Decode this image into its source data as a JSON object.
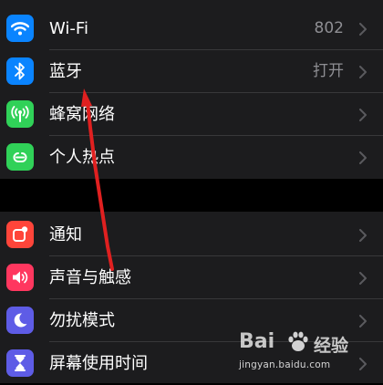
{
  "settings": {
    "group1": [
      {
        "label": "Wi-Fi",
        "value": "802",
        "icon": "wifi-icon",
        "color": "#0a84ff"
      },
      {
        "label": "蓝牙",
        "value": "打开",
        "icon": "bluetooth-icon",
        "color": "#0a84ff"
      },
      {
        "label": "蜂窝网络",
        "value": "",
        "icon": "cellular-antenna-icon",
        "color": "#30d158"
      },
      {
        "label": "个人热点",
        "value": "",
        "icon": "personal-hotspot-icon",
        "color": "#30d158"
      }
    ],
    "group2": [
      {
        "label": "通知",
        "value": "",
        "icon": "notifications-icon",
        "color": "#ff453a"
      },
      {
        "label": "声音与触感",
        "value": "",
        "icon": "speaker-icon",
        "color": "#ff375f"
      },
      {
        "label": "勿扰模式",
        "value": "",
        "icon": "moon-icon",
        "color": "#5e5ce6"
      },
      {
        "label": "屏幕使用时间",
        "value": "",
        "icon": "hourglass-icon",
        "color": "#5e5ce6"
      }
    ]
  },
  "annotation": {
    "type": "red-arrow",
    "points_to": "蓝牙",
    "color": "#e02020"
  },
  "watermark": {
    "brand": "Bai",
    "brand2": "经验",
    "url": "jingyan.baidu.com"
  }
}
